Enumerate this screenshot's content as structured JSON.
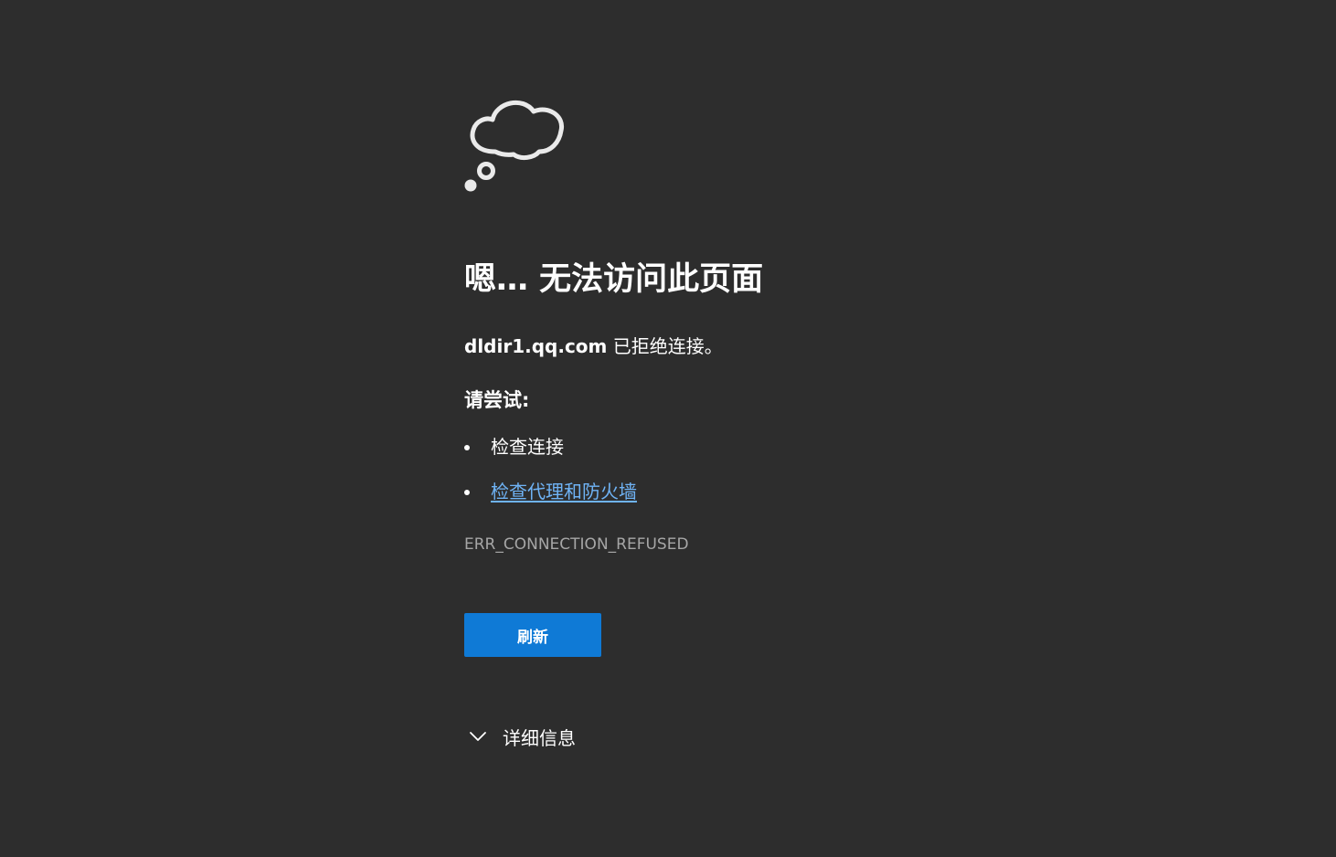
{
  "page": {
    "title": "嗯… 无法访问此页面",
    "host": "dldir1.qq.com",
    "message_suffix": " 已拒绝连接。",
    "try_label": "请尝试:",
    "suggestions": [
      {
        "label": "检查连接",
        "is_link": false
      },
      {
        "label": "检查代理和防火墙",
        "is_link": true
      }
    ],
    "error_code": "ERR_CONNECTION_REFUSED",
    "refresh_label": "刷新",
    "details_label": "详细信息"
  },
  "icons": {
    "illustration": "thought-cloud-icon",
    "details": "chevron-down-icon"
  },
  "colors": {
    "background": "#2d2d2d",
    "text": "#ffffff",
    "link": "#6fb3f5",
    "error_code": "#a6a6a6",
    "button": "#0f7ad6"
  }
}
